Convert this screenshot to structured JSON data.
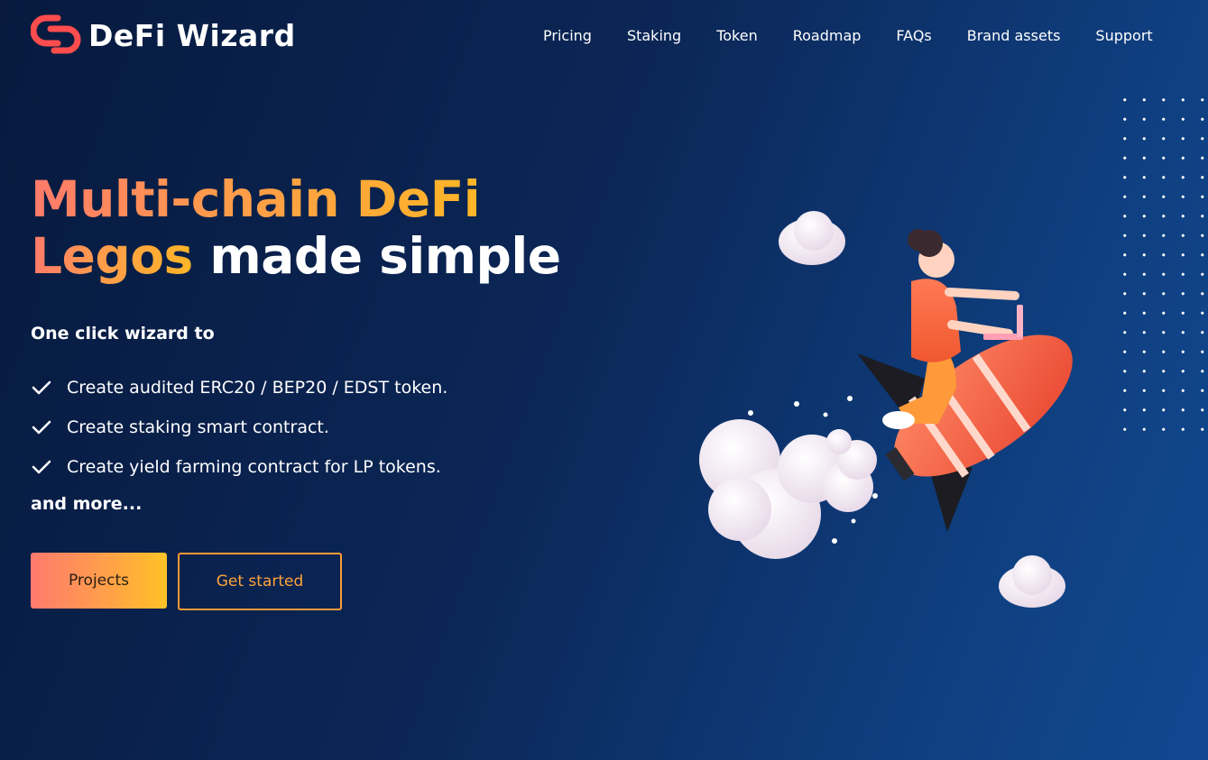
{
  "brand": {
    "name": "DeFi Wizard",
    "logo_icon": "defi-wizard-logo-icon",
    "logo_color": "#ff4a4a"
  },
  "nav": {
    "items": [
      "Pricing",
      "Staking",
      "Token",
      "Roadmap",
      "FAQs",
      "Brand assets",
      "Support"
    ]
  },
  "hero": {
    "title_gradient_line1": "Multi-chain DeFi",
    "title_gradient_line2": "Legos",
    "title_white": "made simple",
    "intro": "One click wizard to",
    "features": [
      "Create audited ERC20 / BEP20 / EDST token.",
      "Create staking smart contract.",
      "Create yield farming contract for LP tokens."
    ],
    "more": "and more...",
    "primary_button": "Projects",
    "secondary_button": "Get started"
  },
  "illustration": {
    "icon": "rocket-rider-illustration"
  },
  "colors": {
    "accent_start": "#ff7a6b",
    "accent_end": "#ffb627",
    "background_dark": "#071a3e",
    "background_light": "#114890"
  }
}
